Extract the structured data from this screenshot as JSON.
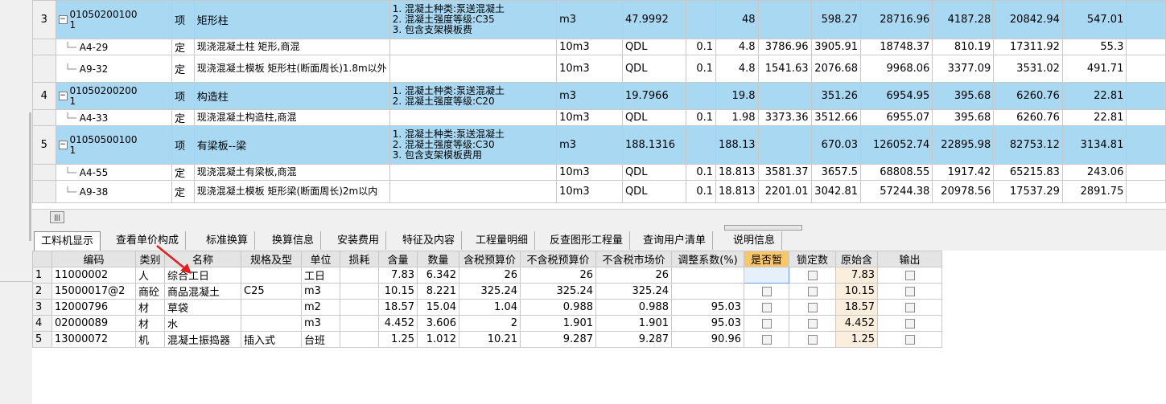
{
  "upper_table": {
    "rows": [
      {
        "type": "parent",
        "idx": "3",
        "code_line1": "01050200100",
        "code_line2": "1",
        "kind": "项",
        "name": "矩形柱",
        "features": [
          "1. 混凝土种类:泵送混凝土",
          "2. 混凝土强度等级:C35",
          "3. 包含支架模板费"
        ],
        "unit": "m3",
        "qty": "47.9992",
        "coef": "",
        "amt": "48",
        "c1": "",
        "c2": "598.27",
        "c3": "28716.96",
        "c4": "4187.28",
        "c5": "20842.94",
        "c6": "547.01"
      },
      {
        "type": "child",
        "idx": "",
        "code": "A4-29",
        "kind": "定",
        "name": "现浇混凝土柱 矩形,商混",
        "features": [],
        "unit": "10m3",
        "qty": "QDL",
        "coef": "0.1",
        "amt": "4.8",
        "c1": "3786.96",
        "c2": "3905.91",
        "c3": "18748.37",
        "c4": "810.19",
        "c5": "17311.92",
        "c6": "55.3"
      },
      {
        "type": "child",
        "idx": "",
        "code": "A9-32",
        "kind": "定",
        "name": "现浇混凝土模板 矩形柱(断面周长)1.8m以外",
        "features": [],
        "unit": "10m3",
        "qty": "QDL",
        "coef": "0.1",
        "amt": "4.8",
        "c1": "1541.63",
        "c2": "2076.68",
        "c3": "9968.06",
        "c4": "3377.09",
        "c5": "3531.02",
        "c6": "491.71"
      },
      {
        "type": "parent",
        "idx": "4",
        "code_line1": "01050200200",
        "code_line2": "1",
        "kind": "项",
        "name": "构造柱",
        "features": [
          "1. 混凝土种类:泵送混凝土",
          "2. 混凝土强度等级:C20"
        ],
        "unit": "m3",
        "qty": "19.7966",
        "coef": "",
        "amt": "19.8",
        "c1": "",
        "c2": "351.26",
        "c3": "6954.95",
        "c4": "395.68",
        "c5": "6260.76",
        "c6": "22.81"
      },
      {
        "type": "child",
        "idx": "",
        "code": "A4-33",
        "kind": "定",
        "name": "现浇混凝土构造柱,商混",
        "features": [],
        "unit": "10m3",
        "qty": "QDL",
        "coef": "0.1",
        "amt": "1.98",
        "c1": "3373.36",
        "c2": "3512.66",
        "c3": "6955.07",
        "c4": "395.68",
        "c5": "6260.76",
        "c6": "22.81"
      },
      {
        "type": "parent",
        "idx": "5",
        "code_line1": "01050500100",
        "code_line2": "1",
        "kind": "项",
        "name": "有梁板--梁",
        "features": [
          "1. 混凝土种类:泵送混凝土",
          "2. 混凝土强度等级:C30",
          "3. 包含支架模板费用"
        ],
        "unit": "m3",
        "qty": "188.1316",
        "coef": "",
        "amt": "188.13",
        "c1": "",
        "c2": "670.03",
        "c3": "126052.74",
        "c4": "22895.98",
        "c5": "82753.12",
        "c6": "3134.81"
      },
      {
        "type": "child",
        "idx": "",
        "code": "A4-55",
        "kind": "定",
        "name": "现浇混凝土有梁板,商混",
        "features": [],
        "unit": "10m3",
        "qty": "QDL",
        "coef": "0.1",
        "amt": "18.813",
        "c1": "3581.37",
        "c2": "3657.5",
        "c3": "68808.55",
        "c4": "1917.42",
        "c5": "65215.83",
        "c6": "243.06"
      },
      {
        "type": "child",
        "idx": "",
        "code": "A9-38",
        "kind": "定",
        "name": "现浇混凝土模板 矩形梁(断面周长)2m以内",
        "features": [],
        "unit": "10m3",
        "qty": "QDL",
        "coef": "0.1",
        "amt": "18.813",
        "c1": "2201.01",
        "c2": "3042.81",
        "c3": "57244.38",
        "c4": "20978.56",
        "c5": "17537.29",
        "c6": "2891.75"
      }
    ]
  },
  "tabs": [
    "工料机显示",
    "查看单价构成",
    "标准换算",
    "换算信息",
    "安装费用",
    "特征及内容",
    "工程量明细",
    "反查图形工程量",
    "查询用户清单",
    "说明信息"
  ],
  "active_tab": "工料机显示",
  "lower_table": {
    "headers": [
      "编码",
      "类别",
      "名称",
      "规格及型",
      "单位",
      "损耗",
      "含量",
      "数量",
      "含税预算价",
      "不含税预算价",
      "不含税市场价",
      "调整系数(%)",
      "是否暂",
      "锁定数",
      "原始含",
      "输出"
    ],
    "rows": [
      {
        "no": "1",
        "code": "11000002",
        "cat": "人",
        "name": "综合工日",
        "spec": "",
        "unit": "工日",
        "loss": "",
        "content": "7.83",
        "qty": "6.342",
        "p1": "26",
        "p2": "26",
        "p3": "26",
        "adj": "",
        "orig": "7.83"
      },
      {
        "no": "2",
        "code": "15000017@2",
        "cat": "商砼",
        "name": "商品混凝土",
        "spec": "C25",
        "unit": "m3",
        "loss": "",
        "content": "10.15",
        "qty": "8.221",
        "p1": "325.24",
        "p2": "325.24",
        "p3": "325.24",
        "adj": "",
        "orig": "10.15"
      },
      {
        "no": "3",
        "code": "12000796",
        "cat": "材",
        "name": "草袋",
        "spec": "",
        "unit": "m2",
        "loss": "",
        "content": "18.57",
        "qty": "15.04",
        "p1": "1.04",
        "p2": "0.988",
        "p3": "0.988",
        "adj": "95.03",
        "orig": "18.57"
      },
      {
        "no": "4",
        "code": "02000089",
        "cat": "材",
        "name": "水",
        "spec": "",
        "unit": "m3",
        "loss": "",
        "content": "4.452",
        "qty": "3.606",
        "p1": "2",
        "p2": "1.901",
        "p3": "1.901",
        "adj": "95.03",
        "orig": "4.452"
      },
      {
        "no": "5",
        "code": "13000072",
        "cat": "机",
        "name": "混凝土振捣器",
        "spec": "插入式",
        "unit": "台班",
        "loss": "",
        "content": "1.25",
        "qty": "1.012",
        "p1": "10.21",
        "p2": "9.287",
        "p3": "9.287",
        "adj": "90.96",
        "orig": "1.25"
      }
    ]
  },
  "colors": {
    "parent_row": "#a9d8f3",
    "header_highlight": "#f9c76b",
    "arrow": "#e02020"
  }
}
